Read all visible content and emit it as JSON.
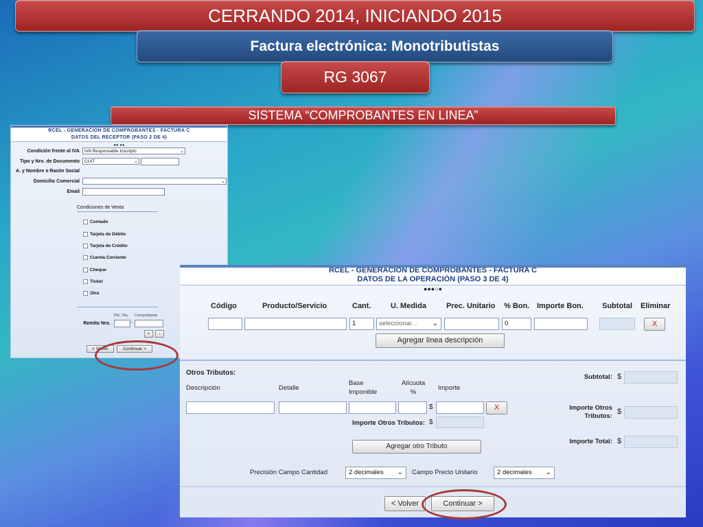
{
  "banners": {
    "title": "CERRANDO 2014, INICIANDO 2015",
    "subtitle": "Factura electrónica: Monotributistas",
    "rg": "RG 3067",
    "system": "SISTEMA “COMPROBANTES EN LINEA”"
  },
  "receptor": {
    "title1": "RCEL - GENERACIÓN DE COMPROBANTES - FACTURA C",
    "title2": "DATOS DEL RECEPTOR (PASO 2 DE 4)",
    "steps": "●● ●●",
    "labels": {
      "condicion_iva": "Condición frente al IVA",
      "tipo_doc": "Tipo y Nro. de Documento",
      "razon_social": "A. y Nombre o Razón Social",
      "domicilio": "Domicilio Comercial",
      "email": "Email"
    },
    "values": {
      "condicion_iva": "IVA Responsable Inscripto",
      "tipo_doc": "CUIT"
    },
    "condiciones_title": "Condiciones de Venta",
    "condiciones": [
      "Contado",
      "Tarjeta de Débito",
      "Tarjeta de Crédito",
      "Cuenta Corriente",
      "Cheque",
      "Ticket",
      "Otra"
    ],
    "remito_hdr1": "Pto. Vta.",
    "remito_hdr2": "Comprobante",
    "remito_label": "Remito Nro.",
    "remito_sep": "-",
    "plus": "+",
    "minus": "-",
    "volver": "< Volver",
    "continuar": "Continuar >"
  },
  "operacion": {
    "title1": "RCEL - GENERACIÓN DE COMPROBANTES - FACTURA C",
    "title2": "DATOS DE LA OPERACIÓN (PASO 3 DE 4)",
    "steps": "●●●○●",
    "headers": [
      "Código",
      "Producto/Servicio",
      "Cant.",
      "U. Medida",
      "Prec. Unitario",
      "% Bon.",
      "Importe Bon.",
      "Subtotal",
      "Eliminar"
    ],
    "row": {
      "cantidad": "1",
      "unidad": "seleccionar...",
      "bonif": "0",
      "eliminar": "X"
    },
    "agregar_linea": "Agregar línea descripción",
    "otros_tributos": {
      "title": "Otros Tributos:",
      "descripcion": "Descripción",
      "detalle": "Detalle",
      "base_imponible": "Base Imponible",
      "alicuota": "Alícuota %",
      "importe": "Importe",
      "dollar": "$",
      "eliminar": "X",
      "importe_otros_label": "Importe Otros Tributos:",
      "agregar": "Agregar otro Tributo"
    },
    "totales": {
      "subtotal": "Subtotal:",
      "importe_otros": "Importe Otros Tributos:",
      "importe_total": "Importe Total:",
      "dollar": "$"
    },
    "precision": {
      "cantidad_label": "Precisión Campo Cantidad",
      "cantidad_value": "2 decimales",
      "precio_label": "Campo Precio Unitario",
      "precio_value": "2 decimales"
    },
    "volver": "< Volver",
    "continuar": "Continuar >"
  },
  "colors": {
    "banner_red": "#b23636",
    "banner_blue": "#2f5a94",
    "ring": "#a83838"
  }
}
